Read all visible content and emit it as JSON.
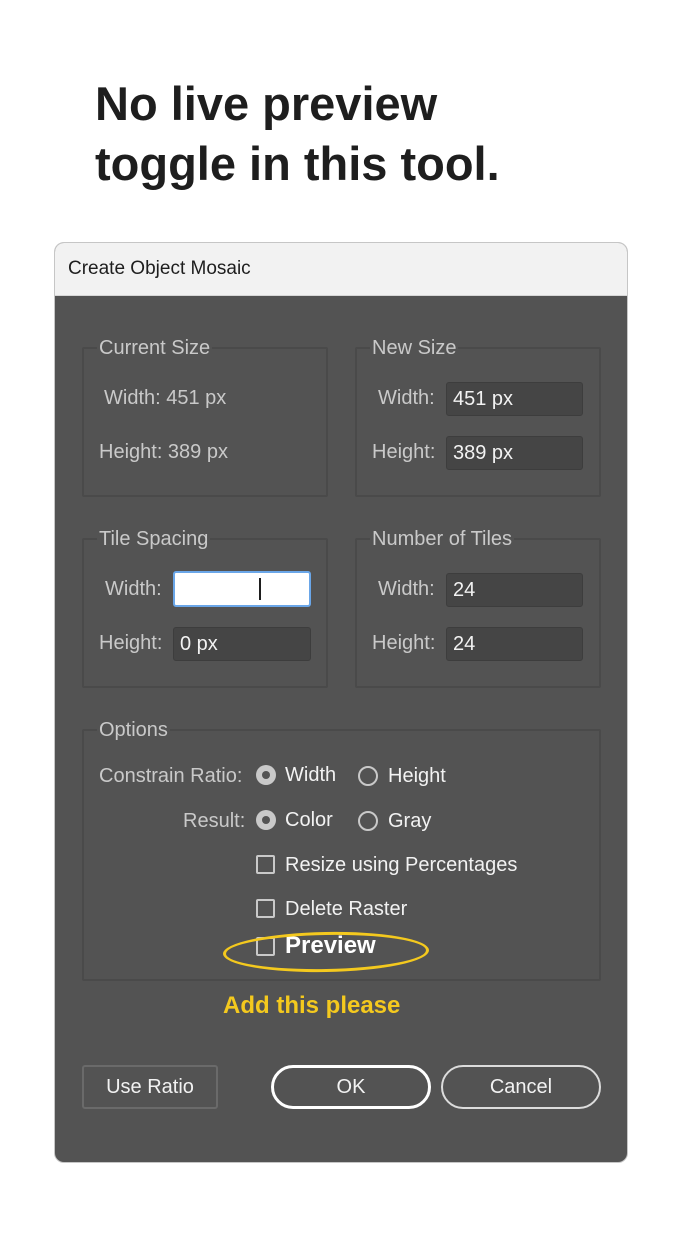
{
  "headline": {
    "line1": "No live preview",
    "line2": "toggle in this tool."
  },
  "dialog": {
    "title": "Create Object Mosaic",
    "current_size": {
      "legend": "Current Size",
      "width_text": "Width: 451 px",
      "height_text": "Height: 389 px"
    },
    "new_size": {
      "legend": "New Size",
      "width_label": "Width:",
      "width_value": "451 px",
      "height_label": "Height:",
      "height_value": "389 px"
    },
    "tile_spacing": {
      "legend": "Tile Spacing",
      "width_label": "Width:",
      "width_value": "",
      "height_label": "Height:",
      "height_value": "0 px"
    },
    "number_of_tiles": {
      "legend": "Number of Tiles",
      "width_label": "Width:",
      "width_value": "24",
      "height_label": "Height:",
      "height_value": "24"
    },
    "options": {
      "legend": "Options",
      "constrain_label": "Constrain Ratio:",
      "constrain_width": "Width",
      "constrain_height": "Height",
      "constrain_selected": "Width",
      "result_label": "Result:",
      "result_color": "Color",
      "result_gray": "Gray",
      "result_selected": "Color",
      "resize_percent": "Resize using Percentages",
      "delete_raster": "Delete Raster",
      "preview": "Preview"
    },
    "annotation": "Add this please",
    "buttons": {
      "use_ratio": "Use Ratio",
      "ok": "OK",
      "cancel": "Cancel"
    }
  },
  "colors": {
    "dialog_bg": "#535353",
    "annotation": "#f4c91e",
    "titlebar_bg": "#f2f2f2"
  }
}
